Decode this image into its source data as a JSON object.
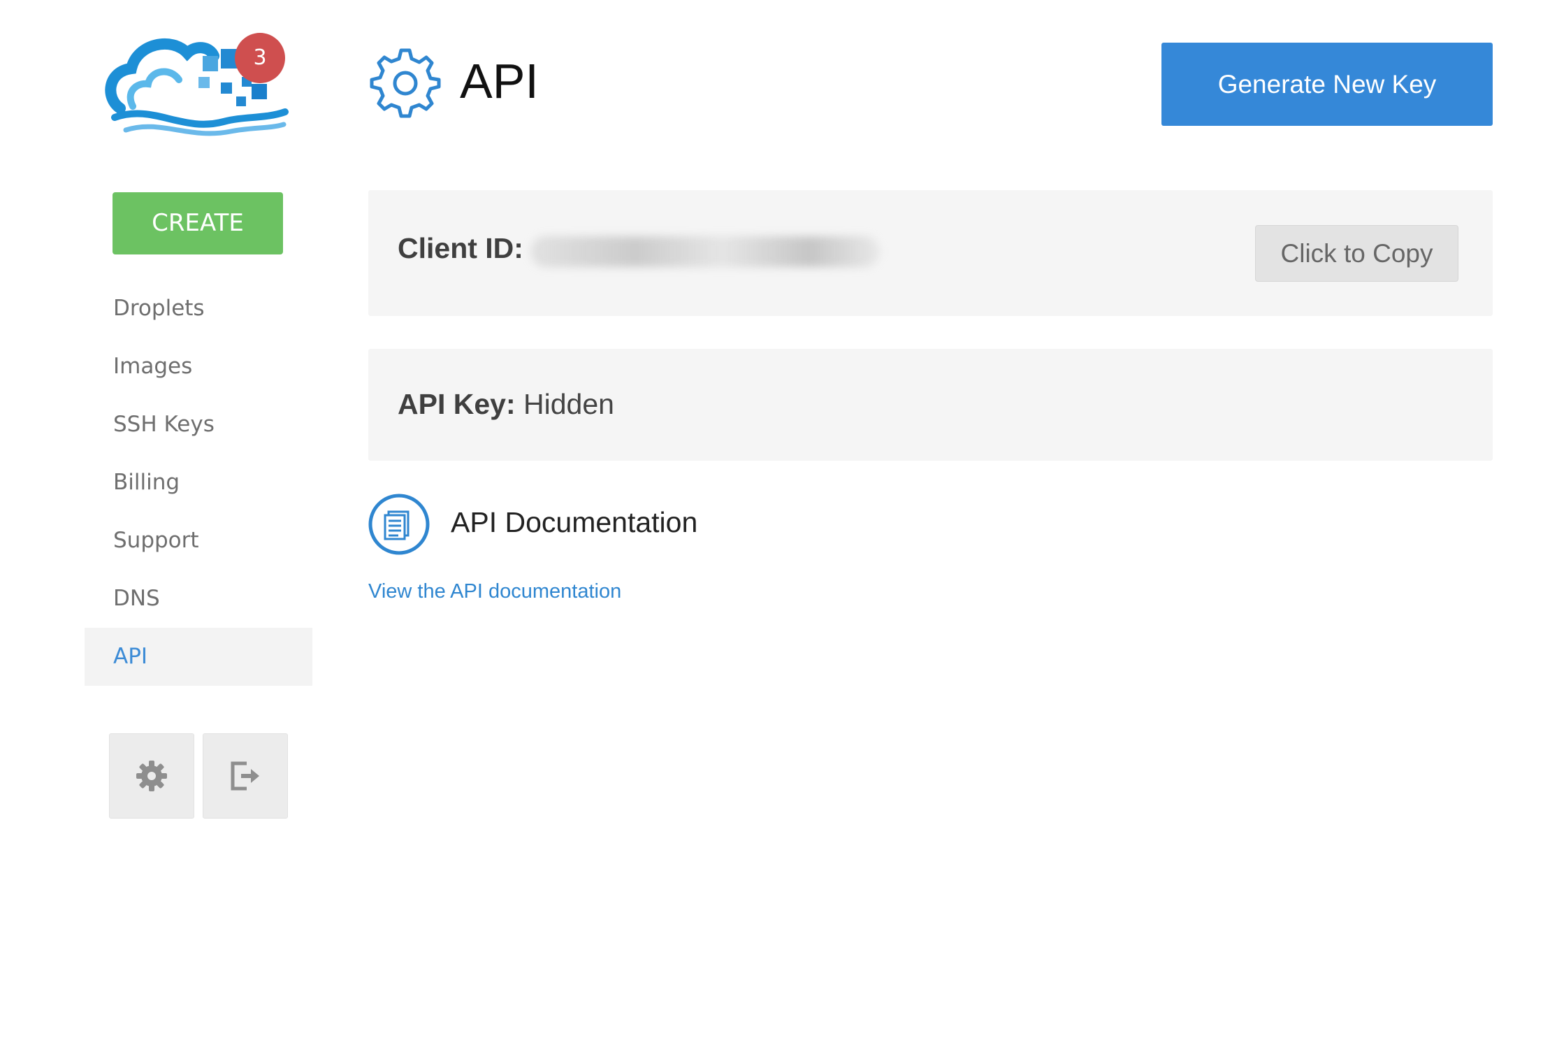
{
  "brand": {
    "logo_icon": "cloud-logo-icon",
    "notification_count": "3",
    "badge_color": "#cf4f4f"
  },
  "sidebar": {
    "create_label": "CREATE",
    "create_color": "#6cc262",
    "items": [
      {
        "label": "Droplets",
        "active": false
      },
      {
        "label": "Images",
        "active": false
      },
      {
        "label": "SSH Keys",
        "active": false
      },
      {
        "label": "Billing",
        "active": false
      },
      {
        "label": "Support",
        "active": false
      },
      {
        "label": "DNS",
        "active": false
      },
      {
        "label": "API",
        "active": true
      }
    ],
    "settings_icon": "gear-icon",
    "logout_icon": "logout-icon"
  },
  "header": {
    "icon": "gear-outline-icon",
    "title": "API",
    "generate_label": "Generate New Key",
    "accent": "#3588d8"
  },
  "client": {
    "label": "Client ID:",
    "copy_label": "Click to Copy"
  },
  "api_key": {
    "label": "API Key:",
    "value": "Hidden"
  },
  "docs": {
    "icon": "document-icon",
    "heading": "API Documentation",
    "link_text": "View the API documentation",
    "link_color": "#2f86d0"
  }
}
